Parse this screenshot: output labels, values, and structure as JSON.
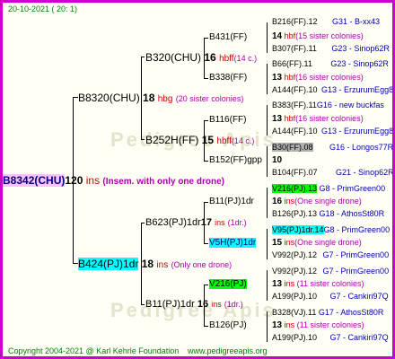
{
  "header": {
    "date": "20-10-2021 ( 20: 1)"
  },
  "watermark": "Pedigree Apis",
  "root": {
    "id": "B8342(CHU)",
    "num": "120",
    "abbr": "ins",
    "note": "(Insem. with only one drone)"
  },
  "gen1": [
    {
      "id": "B8320(CHU)",
      "num": "18",
      "abbr": "hbg",
      "note": "(20 sister colonies)"
    },
    {
      "id": "B424(PJ)1dr",
      "num": "18",
      "abbr": "ins",
      "note": "(Only one drone)"
    }
  ],
  "gen2": [
    {
      "id": "B320(CHU)",
      "num": "16",
      "abbr": "hbff",
      "note": "(14 c.)"
    },
    {
      "id": "B252H(FF)",
      "num": "15",
      "abbr": "hbff",
      "note": "(14 c.)"
    },
    {
      "id": "B623(PJ)1dr",
      "num": "17",
      "abbr": "ins",
      "note": "(1dr.)"
    },
    {
      "id": "B11(PJ)1dr",
      "num": "16",
      "abbr": "ins",
      "note": "(1dr.)"
    }
  ],
  "gen3": [
    {
      "id": "B431(FF)"
    },
    {
      "id": "B338(FF)"
    },
    {
      "id": "B116(FF)"
    },
    {
      "id": "B152(FF)gpp"
    },
    {
      "id": "B11(PJ)1dr"
    },
    {
      "id": "V5H(PJ)1dr"
    },
    {
      "id": "V216(PJ)"
    },
    {
      "id": "B126(PJ)"
    }
  ],
  "gen4": [
    {
      "l1": "B216(FF).12",
      "l1r": "G31 - B-xx43",
      "mid_num": "14",
      "mid_abbr": "hbf",
      "mid_note": "(15 sister colonies)",
      "l2": "B307(FF).11",
      "l2r": "G23 - Sinop62R"
    },
    {
      "l1": "B66(FF).11",
      "l1r": "G23 - Sinop62R",
      "mid_num": "13",
      "mid_abbr": "hbf",
      "mid_note": "(16 sister colonies)",
      "l2": "A144(FF).10",
      "l2r": "G13 - ErzurumEgg8"
    },
    {
      "l1": "B383(FF).11",
      "l1r": "G16 - new buckfas",
      "mid_num": "13",
      "mid_abbr": "hbf",
      "mid_note": "(16 sister colonies)",
      "l2": "A144(FF).10",
      "l2r": "G13 - ErzurumEgg8"
    },
    {
      "l1": "B30(FF).08",
      "l1r": "G16 - Longos77R",
      "mid_num": "10",
      "mid_abbr": "",
      "mid_note": "",
      "l2": "B104(FF).07",
      "l2r": "G21 - Sinop62R"
    },
    {
      "l1": "V216(PJ).13",
      "l1r": "G8 - PrimGreen00",
      "mid_num": "16",
      "mid_abbr": "ins",
      "mid_note": "(One single drone)",
      "l2": "B126(PJ).13",
      "l2r": "G18 - AthosSt80R"
    },
    {
      "l1": "V95(PJ)1dr.14",
      "l1r": "G8 - PrimGreen00",
      "mid_num": "15",
      "mid_abbr": "ins",
      "mid_note": "(One single drone)",
      "l2": "V992(PJ).12",
      "l2r": "G7 - PrimGreen00"
    },
    {
      "l1": "V992(PJ).12",
      "l1r": "G7 - PrimGreen00",
      "mid_num": "13",
      "mid_abbr": "ins",
      "mid_note": "(11 sister colonies)",
      "l2": "A199(PJ).10",
      "l2r": "G7 - Cankiri97Q"
    },
    {
      "l1": "B328(VJ).11",
      "l1r": "G17 - AthosSt80R",
      "mid_num": "13",
      "mid_abbr": "ins",
      "mid_note": "(11 sister colonies)",
      "l2": "A199(PJ).10",
      "l2r": "G7 - Cankiri97Q"
    }
  ],
  "footer": {
    "copyright": "Copyright 2004-2021 @ Karl Kehrle Foundation",
    "site": "www.pedigreeapis.org"
  }
}
